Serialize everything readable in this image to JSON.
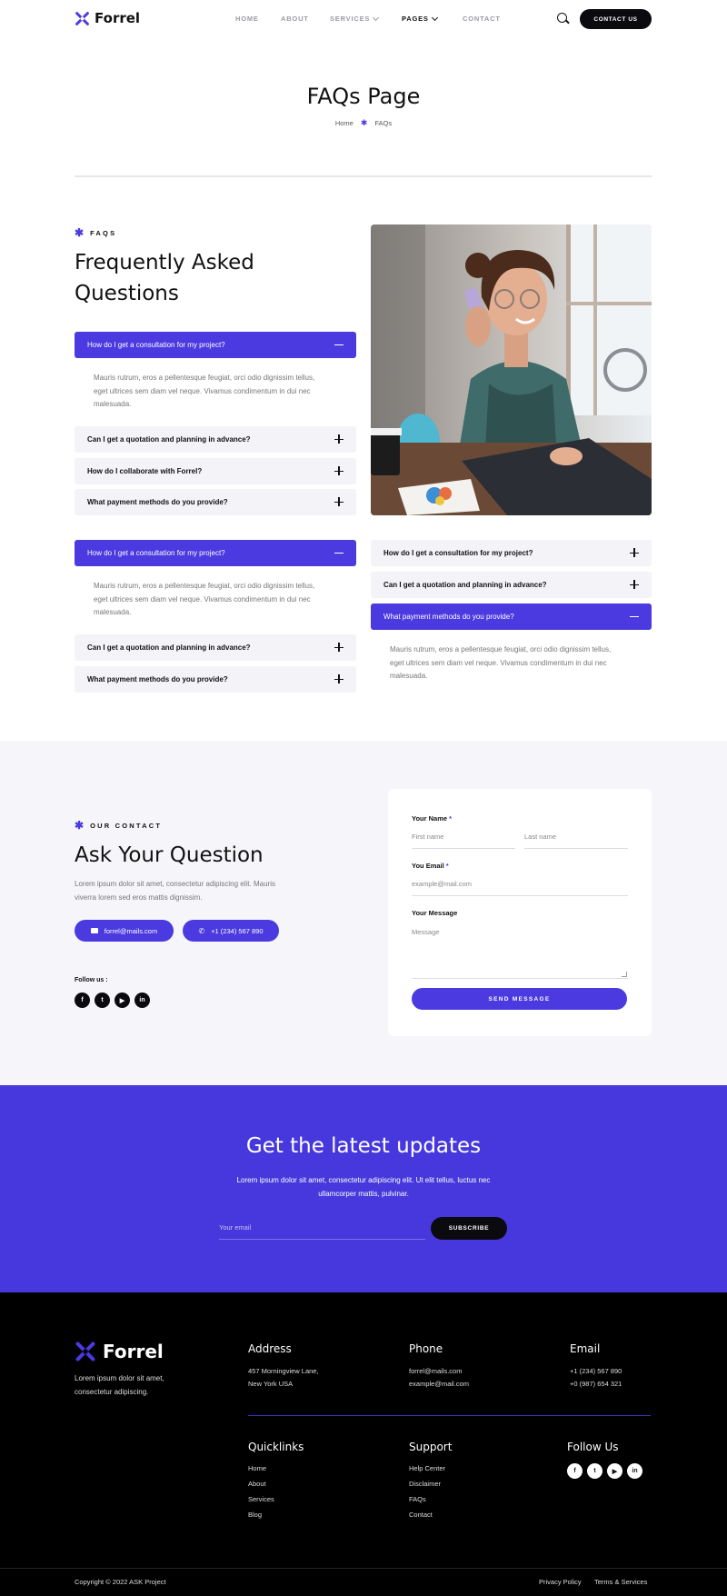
{
  "header": {
    "brand": "Forrel",
    "nav": [
      {
        "label": "HOME"
      },
      {
        "label": "ABOUT"
      },
      {
        "label": "SERVICES"
      },
      {
        "label": "PAGES"
      },
      {
        "label": "CONTACT"
      }
    ],
    "contact_button": "CONTACT US"
  },
  "hero": {
    "title": "FAQs Page",
    "breadcrumb_home": "Home",
    "breadcrumb_current": "FAQs"
  },
  "faq": {
    "eyebrow": "FAQS",
    "heading_line1": "Frequently Asked",
    "heading_line2": "Questions",
    "answer": "Mauris rutrum, eros a pellentesque feugiat, orci odio dignissim tellus, eget ultrices sem diam vel neque. Vivamus condimentum in dui nec malesuada.",
    "group1": [
      {
        "q": "How do I get a consultation for my project?",
        "open": true
      },
      {
        "q": "Can I get a quotation and planning in advance?",
        "open": false
      },
      {
        "q": "How do I collaborate with Forrel?",
        "open": false
      },
      {
        "q": "What payment methods do you provide?",
        "open": false
      }
    ],
    "group2": [
      {
        "q": "How do I get a consultation for my project?",
        "open": true
      },
      {
        "q": "Can I get a quotation and planning in advance?",
        "open": false
      },
      {
        "q": "What payment methods do you provide?",
        "open": false
      }
    ],
    "group3": [
      {
        "q": "How do I get a consultation for my project?",
        "open": false
      },
      {
        "q": "Can I get a quotation and planning in advance?",
        "open": false
      },
      {
        "q": "What payment methods do you provide?",
        "open": true
      }
    ]
  },
  "contact": {
    "eyebrow": "OUR CONTACT",
    "heading": "Ask Your Question",
    "desc": "Lorem ipsum dolor sit amet, consectetur adipiscing elit. Mauris viverra lorem sed eros mattis dignissim.",
    "email": "forrel@mails.com",
    "phone": "+1 (234) 567 890",
    "follow": "Follow us :",
    "social": [
      "facebook-icon",
      "twitter-icon",
      "youtube-icon",
      "linkedin-icon"
    ]
  },
  "form": {
    "name_label": "Your Name",
    "first_placeholder": "First name",
    "last_placeholder": "Last name",
    "email_label": "You Email",
    "email_placeholder": "example@mail.com",
    "message_label": "Your Message",
    "message_placeholder": "Message",
    "required_mark": "*",
    "submit": "SEND MESSAGE"
  },
  "newsletter": {
    "title": "Get the latest updates",
    "desc": "Lorem ipsum dolor sit amet, consectetur adipiscing elit. Ut elit tellus, luctus nec ullamcorper mattis, pulvinar.",
    "placeholder": "Your email",
    "button": "SUBSCRIBE"
  },
  "footer": {
    "brand": "Forrel",
    "desc": "Lorem ipsum dolor sit amet, consectetur adipiscing.",
    "address_h": "Address",
    "address_l1": "457 Morningview Lane,",
    "address_l2": "New York USA",
    "phone_h": "Phone",
    "phone_l1": "forrel@mails.com",
    "phone_l2": "example@mail.com",
    "email_h": "Email",
    "email_l1": "+1 (234) 567 890",
    "email_l2": "+0 (987) 654 321",
    "quick_h": "Quicklinks",
    "quick": [
      "Home",
      "About",
      "Services",
      "Blog"
    ],
    "support_h": "Support",
    "support": [
      "Help Center",
      "Disclaimer",
      "FAQs",
      "Contact"
    ],
    "follow_h": "Follow Us",
    "copyright": "Copyright © 2022 ASK Project",
    "privacy": "Privacy Policy",
    "terms": "Terms & Services"
  },
  "colors": {
    "accent": "#4a3ae0",
    "dark": "#0b0b0f",
    "light_bg": "#f6f6fa"
  }
}
